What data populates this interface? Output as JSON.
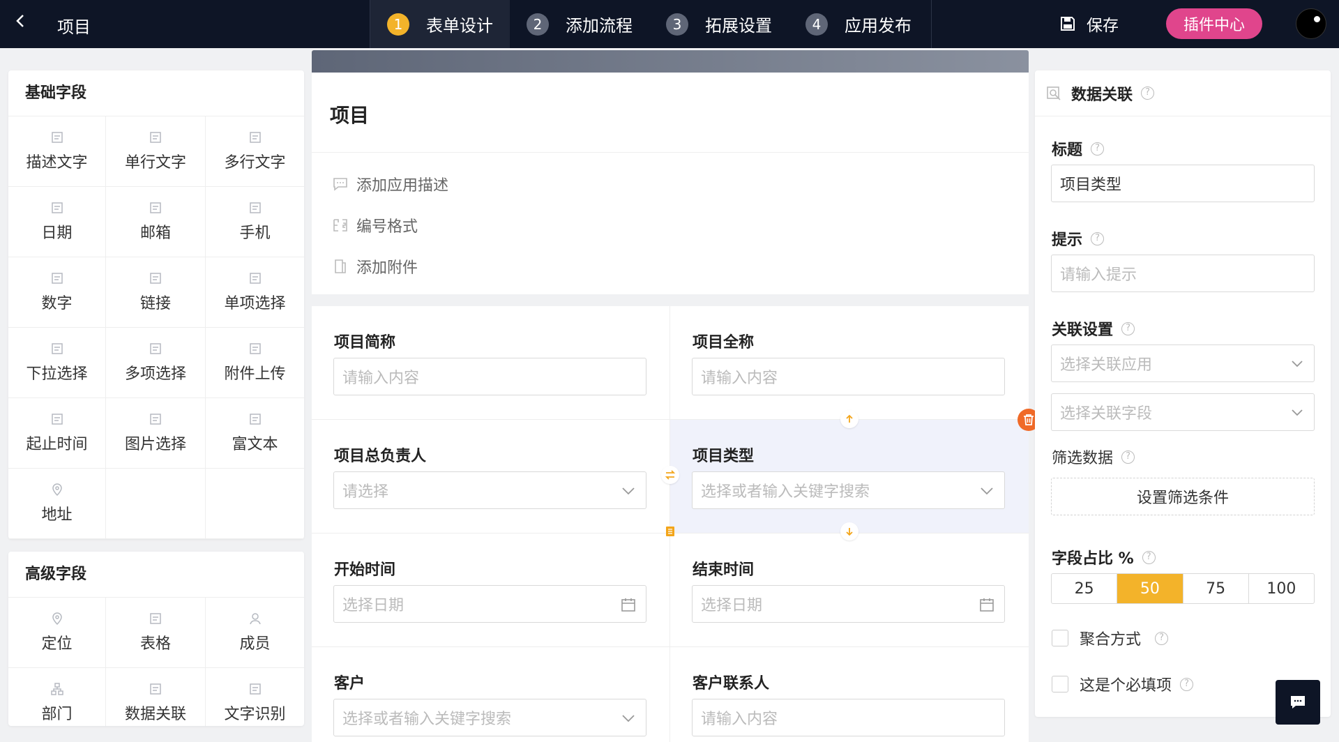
{
  "topbar": {
    "back_icon": "chevron-left-icon",
    "app_title": "项目",
    "steps": [
      {
        "num": "1",
        "label": "表单设计",
        "active": true
      },
      {
        "num": "2",
        "label": "添加流程",
        "active": false
      },
      {
        "num": "3",
        "label": "拓展设置",
        "active": false
      },
      {
        "num": "4",
        "label": "应用发布",
        "active": false
      }
    ],
    "save_label": "保存",
    "plugin_label": "插件中心",
    "colors": {
      "bg": "#0e1526",
      "accent": "#f3b32a",
      "plugin": "#e0458c"
    }
  },
  "basic_fields": {
    "title": "基础字段",
    "items": [
      {
        "label": "描述文字",
        "icon": "text-icon"
      },
      {
        "label": "单行文字",
        "icon": "single-line-icon"
      },
      {
        "label": "多行文字",
        "icon": "multi-line-icon"
      },
      {
        "label": "日期",
        "icon": "calendar-icon"
      },
      {
        "label": "邮箱",
        "icon": "mail-icon"
      },
      {
        "label": "手机",
        "icon": "phone-icon"
      },
      {
        "label": "数字",
        "icon": "number-icon"
      },
      {
        "label": "链接",
        "icon": "link-icon"
      },
      {
        "label": "单项选择",
        "icon": "radio-icon"
      },
      {
        "label": "下拉选择",
        "icon": "dropdown-icon"
      },
      {
        "label": "多项选择",
        "icon": "checkbox-icon"
      },
      {
        "label": "附件上传",
        "icon": "attachment-icon"
      },
      {
        "label": "起止时间",
        "icon": "time-range-icon"
      },
      {
        "label": "图片选择",
        "icon": "image-icon"
      },
      {
        "label": "富文本",
        "icon": "rich-text-icon"
      },
      {
        "label": "地址",
        "icon": "location-pin-icon"
      }
    ]
  },
  "advanced_fields": {
    "title": "高级字段",
    "items": [
      {
        "label": "定位",
        "icon": "location-pin-icon"
      },
      {
        "label": "表格",
        "icon": "table-icon"
      },
      {
        "label": "成员",
        "icon": "user-icon"
      },
      {
        "label": "部门",
        "icon": "org-chart-icon"
      },
      {
        "label": "数据关联",
        "icon": "data-link-icon"
      },
      {
        "label": "文字识别",
        "icon": "ocr-icon"
      }
    ]
  },
  "form": {
    "title": "项目",
    "options": [
      {
        "label": "添加应用描述",
        "icon": "comment-icon"
      },
      {
        "label": "编号格式",
        "icon": "number-format-icon"
      },
      {
        "label": "添加附件",
        "icon": "attachment-icon"
      }
    ],
    "fields": [
      {
        "label": "项目简称",
        "placeholder": "请输入内容",
        "kind": "text"
      },
      {
        "label": "项目全称",
        "placeholder": "请输入内容",
        "kind": "text"
      },
      {
        "label": "项目总负责人",
        "placeholder": "请选择",
        "kind": "select"
      },
      {
        "label": "项目类型",
        "placeholder": "选择或者输入关键字搜索",
        "kind": "select",
        "selected": true
      },
      {
        "label": "开始时间",
        "placeholder": "选择日期",
        "kind": "date"
      },
      {
        "label": "结束时间",
        "placeholder": "选择日期",
        "kind": "date"
      },
      {
        "label": "客户",
        "placeholder": "选择或者输入关键字搜索",
        "kind": "select"
      },
      {
        "label": "客户联系人",
        "placeholder": "请输入内容",
        "kind": "text"
      }
    ]
  },
  "props": {
    "header": "数据关联",
    "title_label": "标题",
    "title_value": "项目类型",
    "hint_label": "提示",
    "hint_placeholder": "请输入提示",
    "link_label": "关联设置",
    "link_app_placeholder": "选择关联应用",
    "link_field_placeholder": "选择关联字段",
    "filter_label": "筛选数据",
    "filter_button": "设置筛选条件",
    "ratio_label": "字段占比 %",
    "ratios": [
      "25",
      "50",
      "75",
      "100"
    ],
    "ratio_selected": "50",
    "aggregate_label": "聚合方式",
    "required_label": "这是个必填项"
  }
}
